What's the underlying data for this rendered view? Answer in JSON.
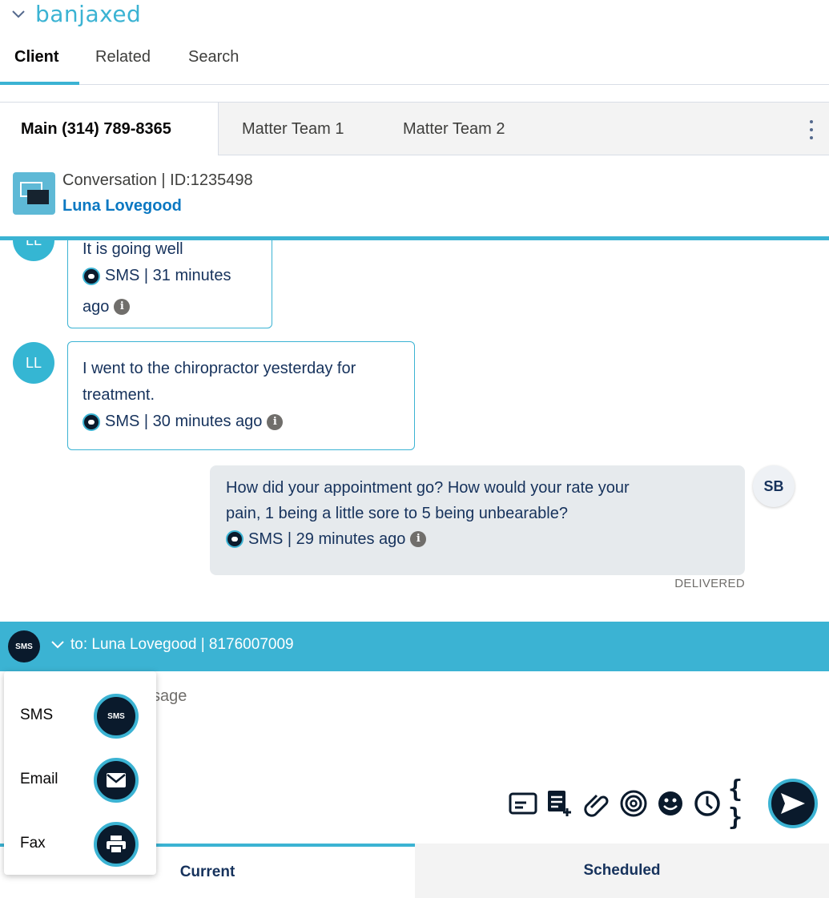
{
  "brand": {
    "logo_text": "banjaxed",
    "accent": "#3bb3d3"
  },
  "top_tabs": [
    {
      "label": "Client",
      "active": true
    },
    {
      "label": "Related",
      "active": false
    },
    {
      "label": "Search",
      "active": false
    }
  ],
  "sub_tabs": [
    {
      "label": "Main (314) 789-8365",
      "active": true
    },
    {
      "label": "Matter Team 1",
      "active": false
    },
    {
      "label": "Matter Team 2",
      "active": false
    }
  ],
  "conversation": {
    "title": "Conversation | ID:1235498",
    "contact_name": "Luna Lovegood"
  },
  "messages": [
    {
      "direction": "in",
      "avatar": "LL",
      "text": "It is going well",
      "meta_line1": "SMS | 31 minutes",
      "meta_line2": "ago"
    },
    {
      "direction": "in",
      "avatar": "LL",
      "text_line1": "I went to the chiropractor yesterday for",
      "text_line2": "treatment.",
      "meta": "SMS | 30 minutes ago"
    },
    {
      "direction": "out",
      "avatar": "SB",
      "text_line1": "How did your appointment go? How would your rate your",
      "text_line2": "pain, 1 being a little sore to 5 being unbearable?",
      "meta": "SMS | 29 minutes ago",
      "status": "DELIVERED"
    }
  ],
  "compose": {
    "channel_badge": "SMS",
    "to_text": "to: Luna Lovegood | 8176007009",
    "placeholder_visible": "ssage"
  },
  "channel_menu": [
    {
      "label": "SMS",
      "icon": "sms-icon",
      "badge": "SMS"
    },
    {
      "label": "Email",
      "icon": "envelope-icon"
    },
    {
      "label": "Fax",
      "icon": "printer-icon"
    }
  ],
  "toolbar_icons": [
    "template-icon",
    "add-note-icon",
    "paperclip-icon",
    "signature-icon",
    "emoji-icon",
    "clock-icon",
    "merge-field-icon",
    "send-icon"
  ],
  "toolbar": {
    "merge_field_glyph": "{ }"
  },
  "bottom_tabs": [
    {
      "label": "Current",
      "active": true
    },
    {
      "label": "Scheduled",
      "active": false
    }
  ],
  "info_glyph": "i"
}
